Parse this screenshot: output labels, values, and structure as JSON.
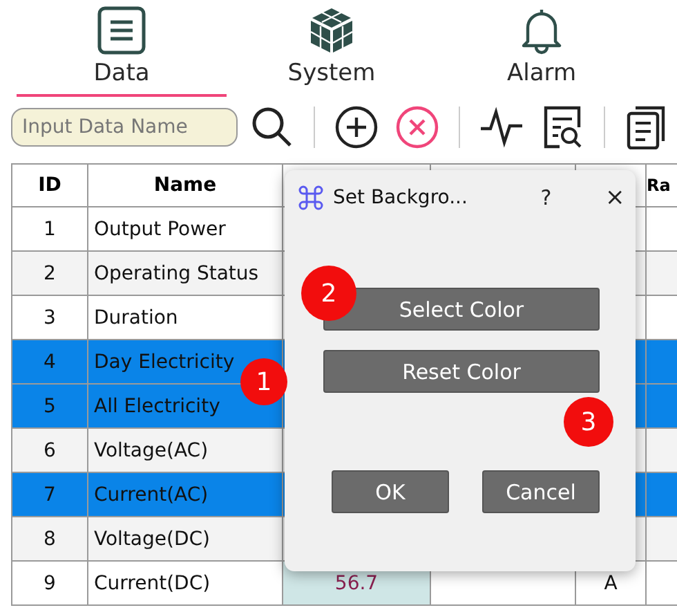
{
  "nav_tabs": [
    {
      "label": "Data",
      "selected": true
    },
    {
      "label": "System",
      "selected": false
    },
    {
      "label": "Alarm",
      "selected": false
    }
  ],
  "toolbar": {
    "search": {
      "placeholder": "Input Data Name"
    }
  },
  "table": {
    "columns": [
      "ID",
      "Name",
      "",
      "",
      "",
      "Ra"
    ],
    "rows": [
      {
        "id": "1",
        "name": "Output Power",
        "selected": false
      },
      {
        "id": "2",
        "name": "Operating Status",
        "selected": false
      },
      {
        "id": "3",
        "name": "Duration",
        "selected": false
      },
      {
        "id": "4",
        "name": "Day Electricity",
        "selected": true
      },
      {
        "id": "5",
        "name": "All Electricity",
        "selected": true
      },
      {
        "id": "6",
        "name": "Voltage(AC)",
        "selected": false
      },
      {
        "id": "7",
        "name": "Current(AC)",
        "selected": true
      },
      {
        "id": "8",
        "name": "Voltage(DC)",
        "selected": false
      },
      {
        "id": "9",
        "name": "Current(DC)",
        "selected": false,
        "column_3": "56.7",
        "column_5": "A"
      }
    ]
  },
  "dialog": {
    "title": "Set Backgro...",
    "help": "?",
    "close": "×",
    "buttons": [
      "Select Color",
      "Reset Color"
    ],
    "footer_buttons": [
      "OK",
      "Cancel"
    ]
  },
  "markers": [
    {
      "label": "1"
    },
    {
      "label": "2"
    },
    {
      "label": "3"
    }
  ]
}
